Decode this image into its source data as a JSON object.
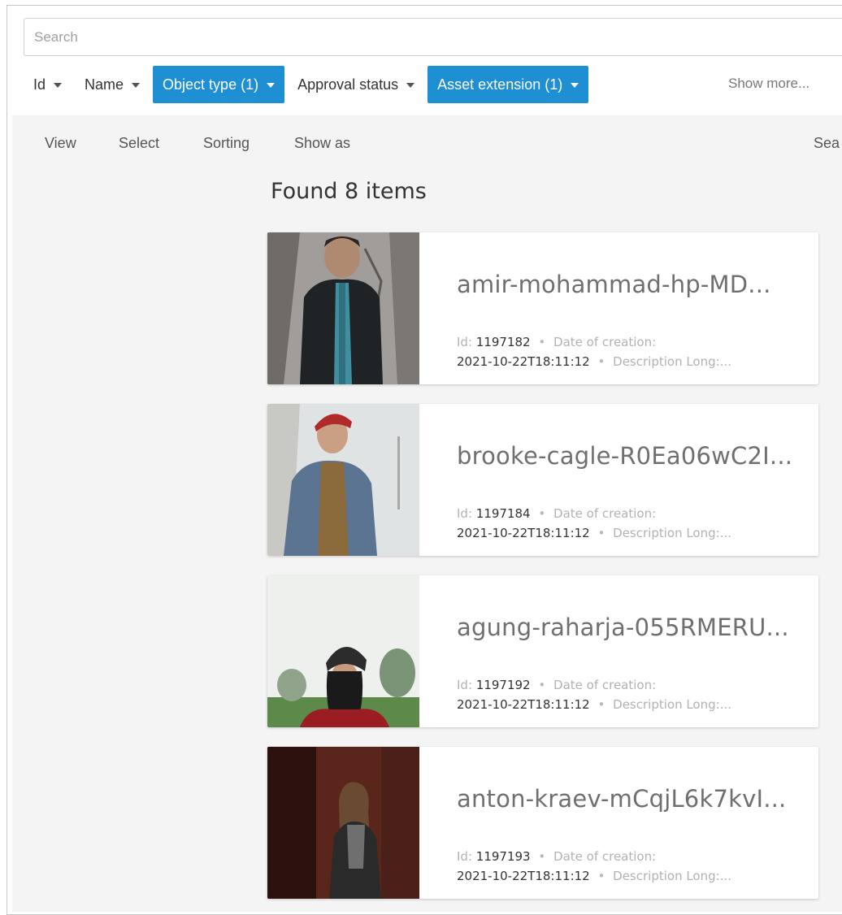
{
  "search": {
    "placeholder": "Search"
  },
  "filters": [
    {
      "label": "Id",
      "active": false
    },
    {
      "label": "Name",
      "active": false
    },
    {
      "label": "Object type (1)",
      "active": true
    },
    {
      "label": "Approval status",
      "active": false
    },
    {
      "label": "Asset extension (1)",
      "active": true
    }
  ],
  "show_more": "Show more...",
  "toolbar": {
    "view": "View",
    "select": "Select",
    "sorting": "Sorting",
    "show_as": "Show as",
    "search": "Sea"
  },
  "results": {
    "title": "Found 8 items",
    "id_label": "Id:",
    "date_label": "Date of creation:",
    "desc_label": "Description Long:...",
    "items": [
      {
        "title": "amir-mohammad-hp-MD...",
        "id": "1197182",
        "date": "2021-10-22T18:11:12"
      },
      {
        "title": "brooke-cagle-R0Ea06wC2I...",
        "id": "1197184",
        "date": "2021-10-22T18:11:12"
      },
      {
        "title": "agung-raharja-055RMERU...",
        "id": "1197192",
        "date": "2021-10-22T18:11:12"
      },
      {
        "title": "anton-kraev-mCqjL6k7kvI...",
        "id": "1197193",
        "date": "2021-10-22T18:11:12"
      }
    ]
  },
  "colors": {
    "accent": "#1e8fd3",
    "panel_bg": "#f4f4f4"
  }
}
